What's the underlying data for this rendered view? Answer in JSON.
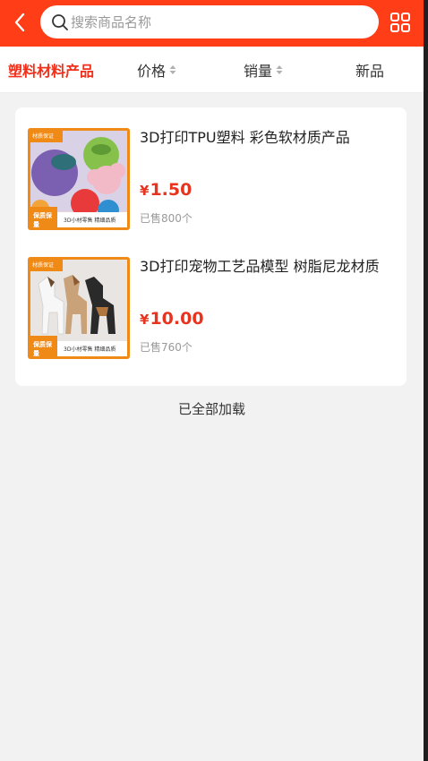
{
  "header": {
    "search_placeholder": "搜索商品名称"
  },
  "filters": {
    "category": "塑料材料产品",
    "price": "价格",
    "sales": "销量",
    "newest": "新品"
  },
  "products": [
    {
      "title": "3D打印TPU塑料 彩色软材质产品",
      "currency": "¥",
      "price": "1.50",
      "sold": "已售800个",
      "thumb": {
        "badge": "材质保证",
        "tag": "保质保量",
        "strip": "3D小材零售 精细品质"
      }
    },
    {
      "title": "3D打印宠物工艺品模型 树脂尼龙材质",
      "currency": "¥",
      "price": "10.00",
      "sold": "已售760个",
      "thumb": {
        "badge": "材质保证",
        "tag": "保质保量",
        "strip": "3D小材零售 精细品质"
      }
    }
  ],
  "footer": {
    "all_loaded": "已全部加载"
  },
  "colors": {
    "header_bg": "#ff3d17",
    "accent": "#f0301a",
    "price": "#e8341f",
    "thumb_frame": "#f08a16"
  },
  "icons": {
    "back": "chevron-left-icon",
    "search": "search-icon",
    "grid": "grid-view-icon",
    "sort": "sort-arrows-icon"
  }
}
